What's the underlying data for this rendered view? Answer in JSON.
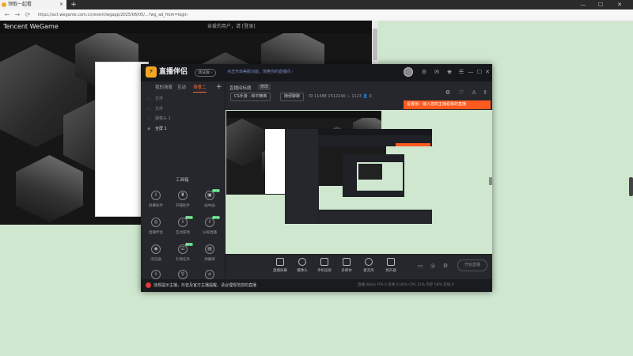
{
  "browser": {
    "tab_title": "领取一起看",
    "tab_close": "×",
    "new_tab": "+",
    "window_controls": [
      "—",
      "☐",
      "✕"
    ],
    "nav": [
      "←",
      "→",
      "⟳"
    ],
    "address": "https://act.wegame.com.cn/event/wgapp/2025/06/05/...?wg_ad_from=login"
  },
  "wegame": {
    "logo_text": "Tencent WeGame",
    "login_text": "亲爱的用户，请 [登录]"
  },
  "app": {
    "title": "直播伴侣",
    "version": "测试版 ›",
    "notice": "点击开启美颜功能，惊艳你的直播间 ›",
    "title_icons": [
      "⚙",
      "✉",
      "♚",
      "☰",
      "—",
      "☐",
      "✕"
    ],
    "sidebar_tabs": [
      "我的场景",
      "互动",
      "场景二"
    ],
    "sidebar_add": "+",
    "scene_rows": [
      "文件",
      "文件",
      "摄像头 1",
      "全屏 1"
    ],
    "tools_title": "工具箱",
    "tools": [
      {
        "label": "屏幕助手",
        "icon": "⇩",
        "badge": ""
      },
      {
        "label": "开播助手",
        "icon": "♜",
        "badge": ""
      },
      {
        "label": "画中画",
        "icon": "▣",
        "badge": "NEW"
      },
      {
        "label": "直播伴侣",
        "icon": "◎",
        "badge": ""
      },
      {
        "label": "互动游戏",
        "icon": "⇩",
        "badge": "NEW"
      },
      {
        "label": "分屏直播",
        "icon": "⇩",
        "badge": "NEW"
      },
      {
        "label": "浏览器",
        "icon": "◉",
        "badge": ""
      },
      {
        "label": "礼物任务",
        "icon": "☑",
        "badge": "NEW"
      },
      {
        "label": "弹幕库",
        "icon": "▤",
        "badge": ""
      },
      {
        "label": "",
        "icon": "⇩",
        "badge": ""
      },
      {
        "label": "",
        "icon": "⚲",
        "badge": ""
      },
      {
        "label": "",
        "icon": "⌂",
        "badge": ""
      }
    ],
    "room": {
      "name": "直播间标题",
      "edit": "修改",
      "category": "CS手游 · 和平精英",
      "tag": "随便聊聊",
      "stats": "ID 11488   1512240   ♨ 1123   👤 0"
    },
    "main_icons": [
      "⚙",
      "♡",
      "⚠",
      "⇪"
    ],
    "orange_notice": "设置版：输入您的主播看我的直播",
    "bottom_tools": [
      {
        "label": "直播屏幕",
        "round": false
      },
      {
        "label": "摄像头",
        "round": true
      },
      {
        "label": "手机投屏",
        "round": false
      },
      {
        "label": "多媒体",
        "round": false
      },
      {
        "label": "麦克风",
        "round": true
      },
      {
        "label": "扬声器",
        "round": false
      }
    ],
    "bottom_small_icons": [
      "▭",
      "◎",
      "⚙"
    ],
    "start_live": "开始直播",
    "status_warning": "违规提示主播，抖音及官方主播提醒，请合理规范您的直播",
    "status_right": "直播 0Kb/s   FPS 0   丢帧 0.00%   CPU 12%   内存 58%   在线 0"
  }
}
